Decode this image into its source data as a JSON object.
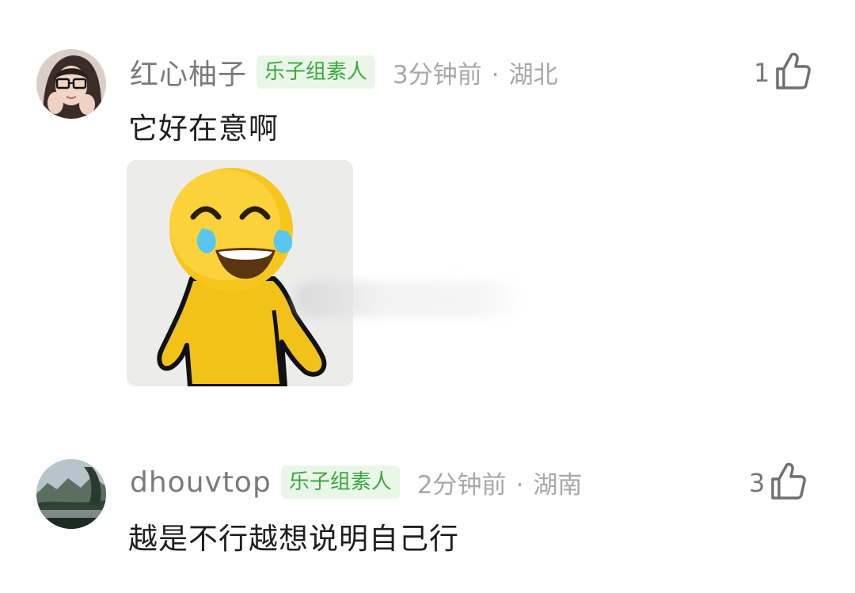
{
  "comments": [
    {
      "username": "红心柚子",
      "badge": "乐子组素人",
      "time": "3分钟前",
      "separator": "·",
      "location": "湖北",
      "likes": "1",
      "text": "它好在意啊",
      "avatar_icon": "user-avatar-portrait",
      "sticker_icon": "laughing-tears-emoji-sticker"
    },
    {
      "username": "dhouvtop",
      "badge": "乐子组素人",
      "time": "2分钟前",
      "separator": "·",
      "location": "湖南",
      "likes": "3",
      "text": "越是不行越想说明自己行",
      "avatar_icon": "user-avatar-landscape"
    }
  ],
  "icons": {
    "like": "thumbs-up-icon"
  },
  "colors": {
    "badge_bg": "#eaf7e8",
    "badge_text": "#3aa940",
    "username": "#7a7a7a",
    "meta": "#a8a8a8",
    "text": "#1e1e1e"
  }
}
